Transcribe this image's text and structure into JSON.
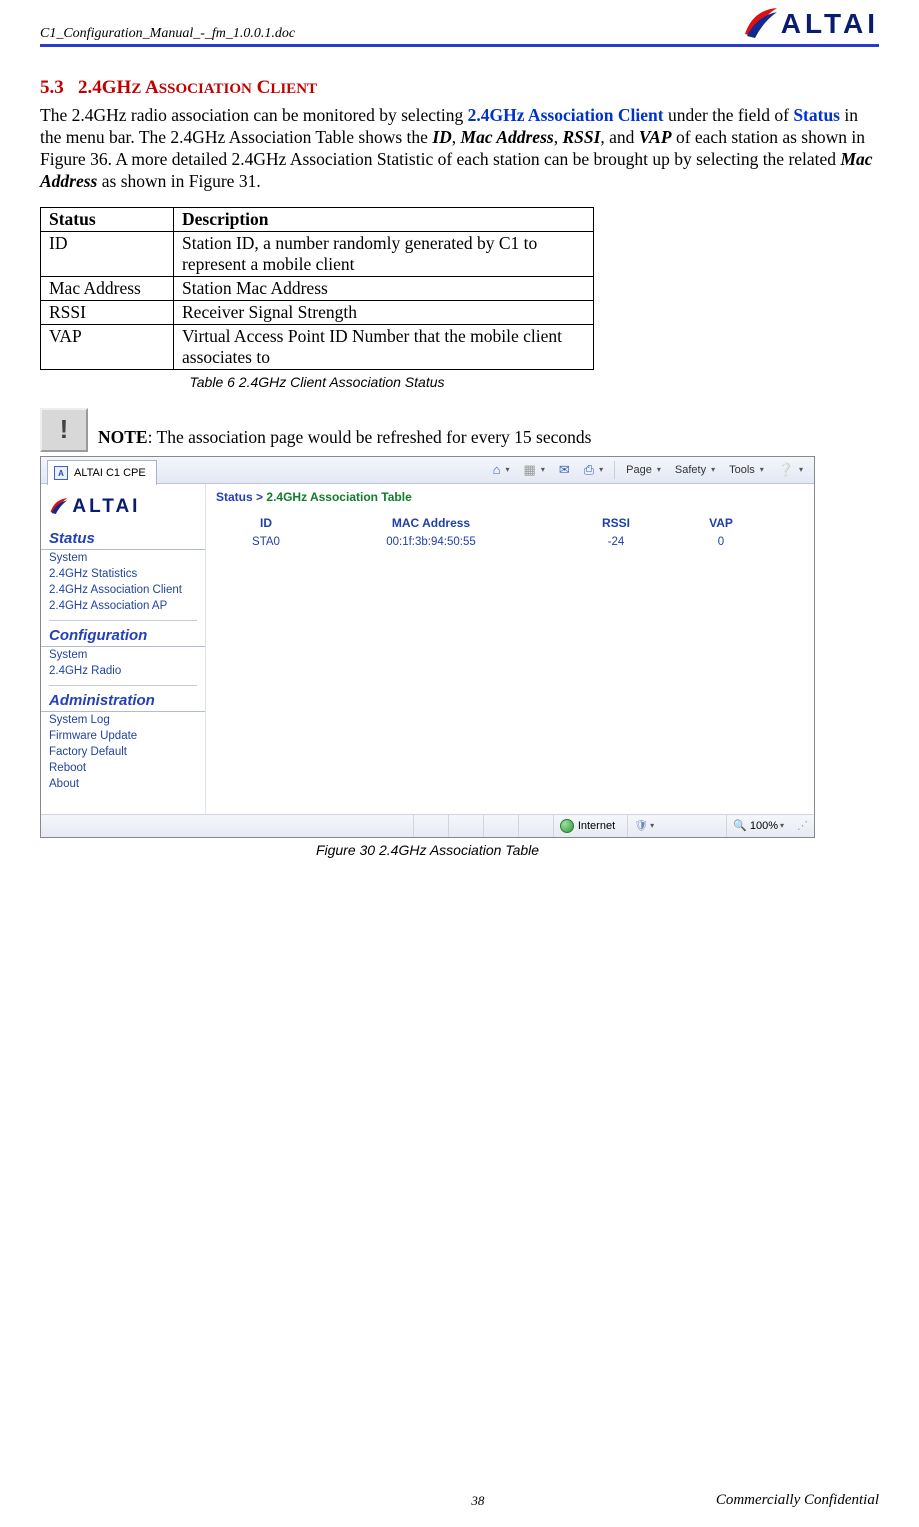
{
  "header": {
    "doc_name": "C1_Configuration_Manual_-_fm_1.0.0.1.doc",
    "logo_text": "ALTAI"
  },
  "section": {
    "number": "5.3",
    "title_main": "2.4GH",
    "title_sc1": "Z",
    "title_sp1": " A",
    "title_sc2": "SSOCIATION",
    "title_sp2": " C",
    "title_sc3": "LIENT"
  },
  "para": {
    "p1a": "The 2.4GHz radio association can be monitored by selecting ",
    "p1b": "2.4GHz Association Client",
    "p1c": " under the field of ",
    "p1d": "Status",
    "p1e": " in the menu bar. The 2.4GHz Association Table shows the ",
    "p1f": "ID",
    "p1g": ", ",
    "p1h": "Mac Address",
    "p1i": ", ",
    "p1j": "RSSI",
    "p1k": ", and ",
    "p1l": "VAP",
    "p1m": " of each station as shown in Figure 36. A more detailed 2.4GHz Association Statistic of each station can be brought up by selecting the related ",
    "p1n": "Mac Address",
    "p1o": " as shown in Figure 31."
  },
  "table": {
    "h1": "Status",
    "h2": "Description",
    "rows": [
      {
        "s": "ID",
        "d": "Station ID, a number randomly generated by C1 to represent a mobile client"
      },
      {
        "s": "Mac Address",
        "d": "Station Mac Address"
      },
      {
        "s": "RSSI",
        "d": "Receiver Signal Strength"
      },
      {
        "s": "VAP",
        "d": "Virtual Access Point ID Number that the mobile client associates to"
      }
    ],
    "caption_lead": "Table 6",
    "caption_text": "   2.4GHz Client Association Status"
  },
  "note": {
    "label": "NOTE",
    "text": ": The association page would be refreshed for every 15 seconds"
  },
  "screenshot": {
    "tab_title": "ALTAI C1 CPE",
    "toolbar": {
      "page": "Page",
      "safety": "Safety",
      "tools": "Tools"
    },
    "logo": "ALTAI",
    "sidebar": {
      "head_status": "Status",
      "items_status": [
        "System",
        "2.4GHz Statistics",
        "2.4GHz Association Client",
        "2.4GHz Association AP"
      ],
      "head_config": "Configuration",
      "items_config": [
        "System",
        "2.4GHz Radio"
      ],
      "head_admin": "Administration",
      "items_admin": [
        "System Log",
        "Firmware Update",
        "Factory Default",
        "Reboot",
        "About"
      ]
    },
    "breadcrumb": {
      "status": "Status",
      "sep": ">",
      "page": "2.4GHz Association Table"
    },
    "cols": {
      "id": "ID",
      "mac": "MAC Address",
      "rssi": "RSSI",
      "vap": "VAP"
    },
    "row": {
      "id": "STA0",
      "mac": "00:1f:3b:94:50:55",
      "rssi": "-24",
      "vap": "0"
    },
    "status_strip": {
      "internet": "Internet",
      "zoom": "100%"
    }
  },
  "figure": {
    "caption_lead": "Figure 30",
    "caption_text": "   2.4GHz Association Table"
  },
  "footer": {
    "page_number": "38",
    "confidential": "Commercially Confidential"
  }
}
